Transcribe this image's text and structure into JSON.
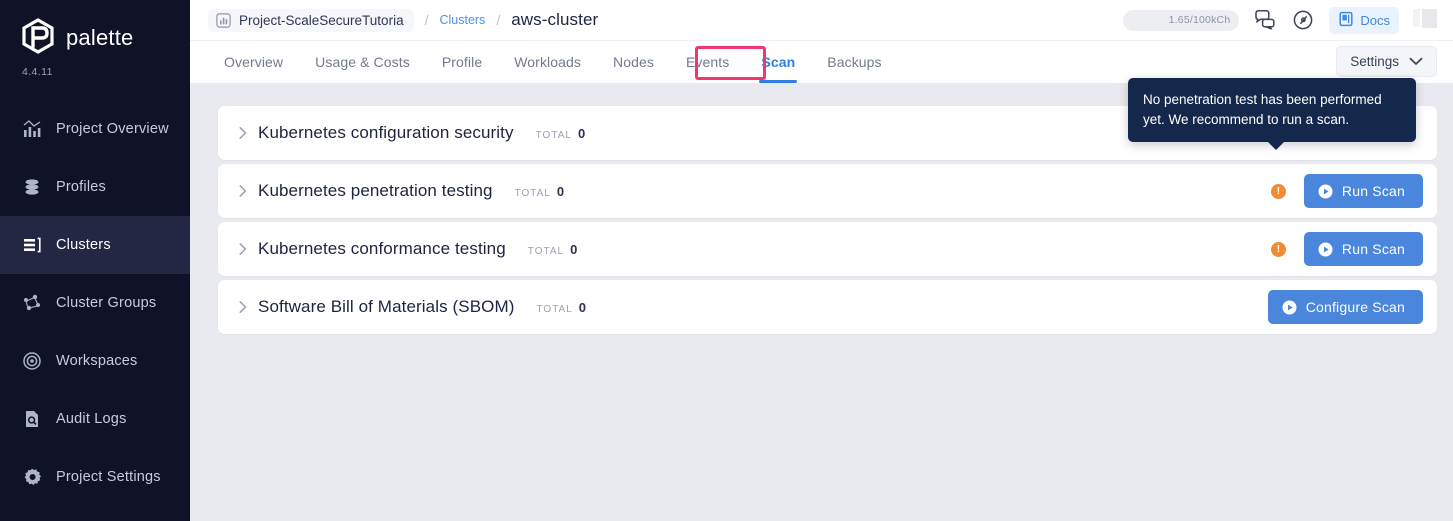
{
  "sidebar": {
    "brand": {
      "name": "palette",
      "version": "4.4.11",
      "logo_icon": "palette-hexagon-logo"
    },
    "items": [
      {
        "label": "Project Overview",
        "icon": "chart-bars-icon",
        "active": false
      },
      {
        "label": "Profiles",
        "icon": "stack-database-icon",
        "active": false
      },
      {
        "label": "Clusters",
        "icon": "clusters-list-icon",
        "active": true
      },
      {
        "label": "Cluster Groups",
        "icon": "cluster-groups-nodes-icon",
        "active": false
      },
      {
        "label": "Workspaces",
        "icon": "target-circle-icon",
        "active": false
      },
      {
        "label": "Audit Logs",
        "icon": "document-search-icon",
        "active": false
      },
      {
        "label": "Project Settings",
        "icon": "gear-icon",
        "active": false
      }
    ]
  },
  "topbar": {
    "project_chip": {
      "label": "Project-ScaleSecureTutoria",
      "icon": "project-chart-icon"
    },
    "separator": "/",
    "breadcrumb_link": "Clusters",
    "current_page": "aws-cluster",
    "usage_pill": "1.65/100kCh",
    "chat_icon": "chat-bubbles-icon",
    "compass_icon": "compass-icon",
    "docs": {
      "label": "Docs",
      "icon": "book-icon"
    },
    "avatar": "user-avatar-skeleton"
  },
  "tabs": [
    {
      "label": "Overview",
      "active": false
    },
    {
      "label": "Usage & Costs",
      "active": false
    },
    {
      "label": "Profile",
      "active": false
    },
    {
      "label": "Workloads",
      "active": false
    },
    {
      "label": "Nodes",
      "active": false
    },
    {
      "label": "Events",
      "active": false
    },
    {
      "label": "Scan",
      "active": true
    },
    {
      "label": "Backups",
      "active": false
    }
  ],
  "settings_button": {
    "label": "Settings",
    "icon": "chevron-down-icon"
  },
  "annotation": {
    "color": "#f4356e",
    "target_tab": "Scan"
  },
  "tooltip": {
    "text": "No penetration test has been performed yet. We recommend to run a scan."
  },
  "scan_rows": [
    {
      "title": "Kubernetes configuration security",
      "total_label": "TOTAL",
      "total_value": "0",
      "chevron": "chevron-right-icon",
      "warning": false,
      "action": null
    },
    {
      "title": "Kubernetes penetration testing",
      "total_label": "TOTAL",
      "total_value": "0",
      "chevron": "chevron-right-icon",
      "warning": true,
      "warning_mark": "!",
      "action": {
        "label": "Run Scan",
        "icon": "play-circle-icon"
      }
    },
    {
      "title": "Kubernetes conformance testing",
      "total_label": "TOTAL",
      "total_value": "0",
      "chevron": "chevron-right-icon",
      "warning": true,
      "warning_mark": "!",
      "action": {
        "label": "Run Scan",
        "icon": "play-circle-icon"
      }
    },
    {
      "title": "Software Bill of Materials (SBOM)",
      "total_label": "TOTAL",
      "total_value": "0",
      "chevron": "chevron-right-icon",
      "warning": false,
      "action": {
        "label": "Configure Scan",
        "icon": "play-circle-icon"
      }
    }
  ],
  "colors": {
    "sidebar_bg": "#101328",
    "accent_blue": "#4a86db",
    "link_blue": "#4a90e2",
    "warning_orange": "#f08c36",
    "annotation_pink": "#f4356e",
    "tooltip_navy": "#14284b",
    "page_bg": "#e9eaef"
  }
}
